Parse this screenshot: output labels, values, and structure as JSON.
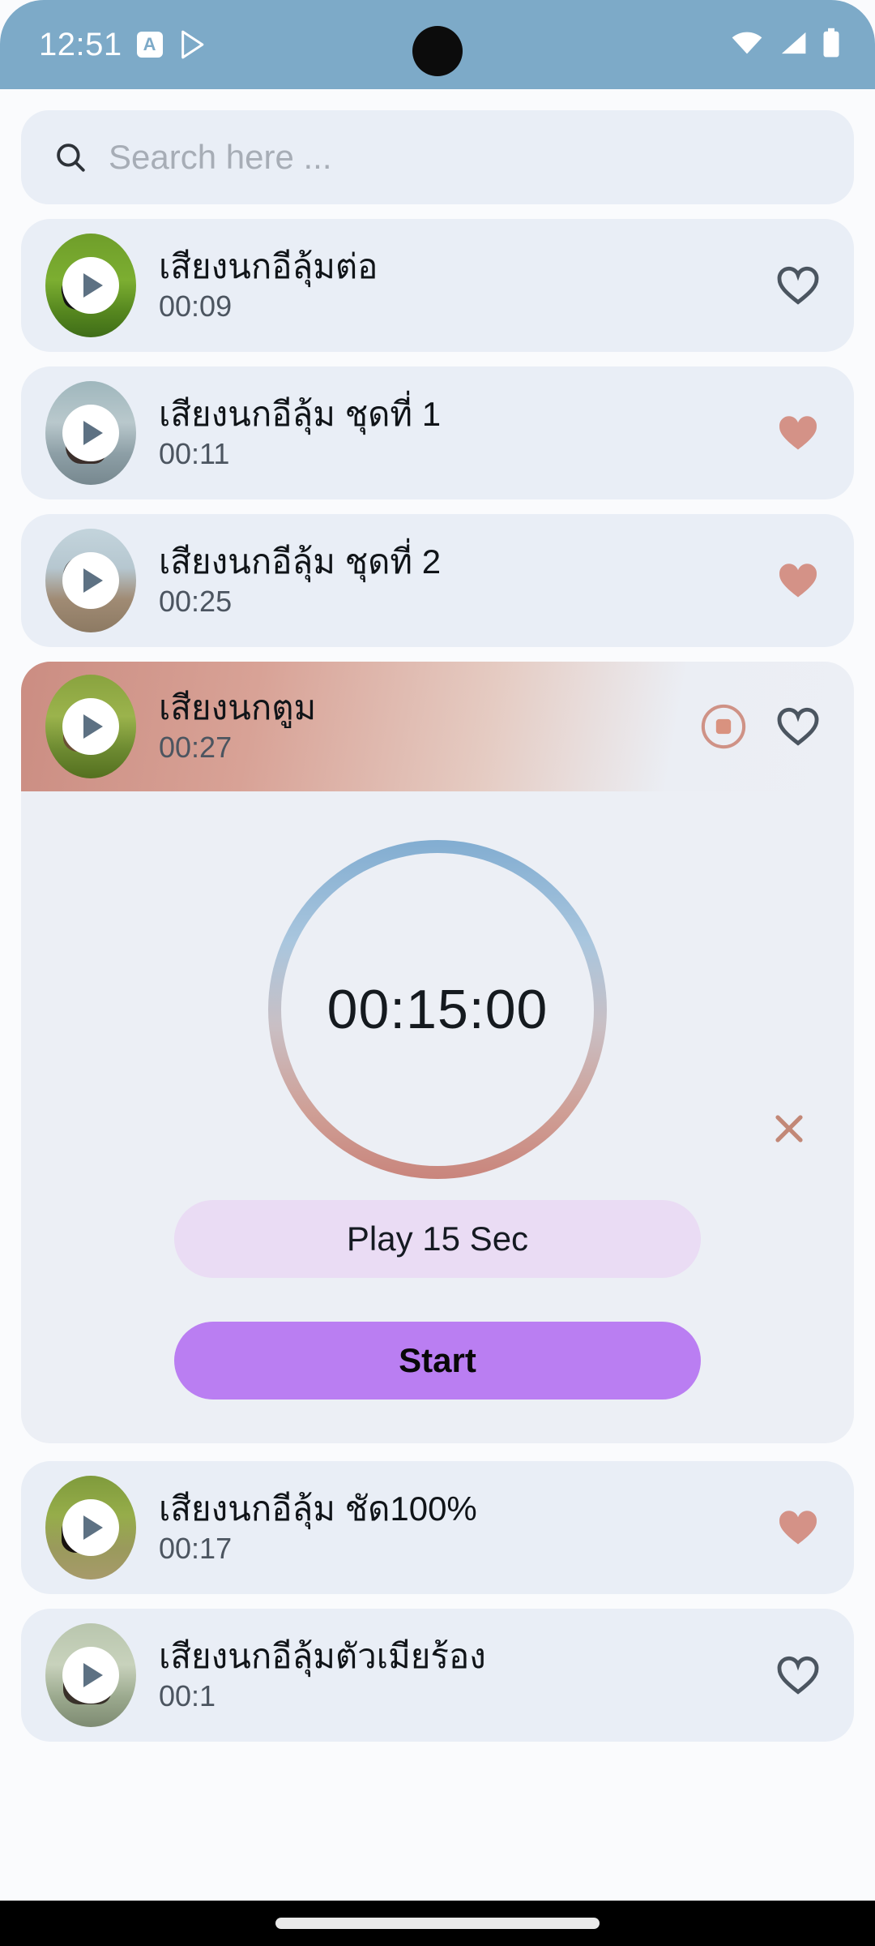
{
  "status_bar": {
    "time": "12:51",
    "badge_letter": "A",
    "icons": [
      "a-badge-icon",
      "play-store-icon",
      "wifi-icon",
      "cellular-signal-icon",
      "battery-icon"
    ],
    "background_color": "#7daac8"
  },
  "search": {
    "placeholder": "Search here ...",
    "value": "",
    "icon": "search-icon"
  },
  "theme": {
    "page_background": "#fafbfd",
    "card_background": "#e9eef6",
    "accent_salmon": "#cd8f83",
    "accent_purple": "#ba7ef2",
    "accent_lavender": "#eadcf4",
    "heart_filled": "#d49287",
    "heart_outline": "#4b5560"
  },
  "sounds": [
    {
      "title": "เสียงนกอีลุ้มต่อ",
      "duration": "00:09",
      "favorited": false,
      "playing": false,
      "thumb": "bird-on-green-grass"
    },
    {
      "title": "เสียงนกอีลุ้ม ชุดที่ 1",
      "duration": "00:11",
      "favorited": true,
      "playing": false,
      "thumb": "bird-in-reeds-water"
    },
    {
      "title": "เสียงนกอีลุ้ม ชุดที่ 2",
      "duration": "00:25",
      "favorited": true,
      "playing": false,
      "thumb": "bird-on-sandbank"
    },
    {
      "title": "เสียงนกตูม",
      "duration": "00:27",
      "favorited": false,
      "playing": true,
      "thumb": "duck-in-tall-grass"
    },
    {
      "title": "เสียงนกอีลุ้ม ชัด100%",
      "duration": "00:17",
      "favorited": true,
      "playing": false,
      "thumb": "dark-bird-in-grass"
    },
    {
      "title": "เสียงนกอีลุ้มตัวเมียร้อง",
      "duration": "00:1",
      "favorited": false,
      "playing": false,
      "thumb": "female-bird-in-reeds"
    }
  ],
  "timer_panel": {
    "display": "00:15:00",
    "close_label": "×",
    "play_button_label": "Play 15 Sec",
    "start_button_label": "Start",
    "stop_icon": "stop-icon",
    "ring_gradient_top": "#82add1",
    "ring_gradient_bottom": "#c9857c"
  }
}
